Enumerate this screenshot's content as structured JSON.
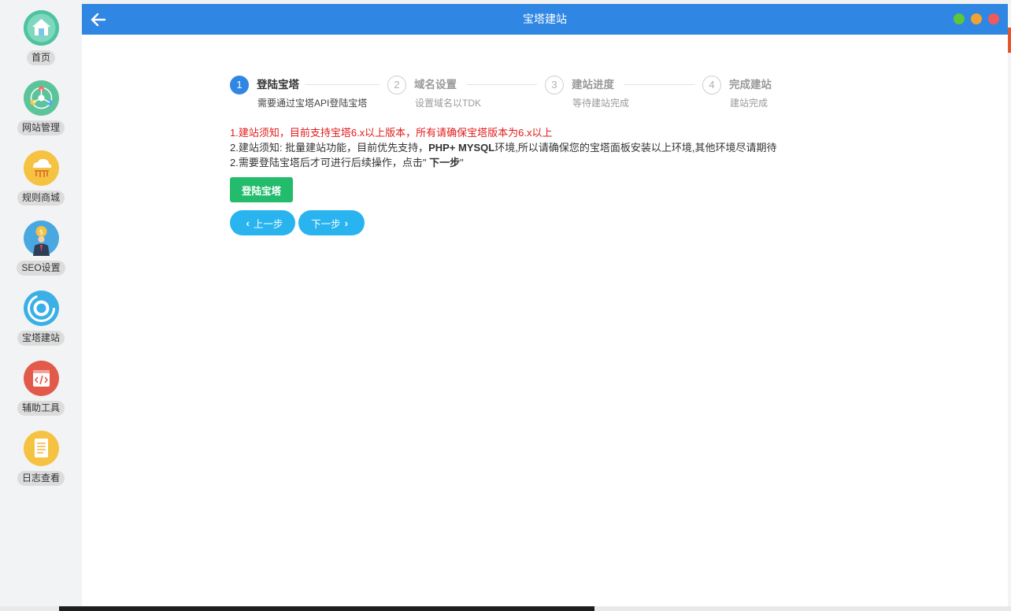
{
  "window": {
    "title": "宝塔建站"
  },
  "sidebar": {
    "items": [
      {
        "label": "首页",
        "icon": "home-icon"
      },
      {
        "label": "网站管理",
        "icon": "network-icon"
      },
      {
        "label": "规则商城",
        "icon": "cloud-icon"
      },
      {
        "label": "SEO设置",
        "icon": "seo-person-icon"
      },
      {
        "label": "宝塔建站",
        "icon": "bt-icon"
      },
      {
        "label": "辅助工具",
        "icon": "code-icon"
      },
      {
        "label": "日志查看",
        "icon": "document-icon"
      }
    ]
  },
  "steps": [
    {
      "num": "1",
      "title": "登陆宝塔",
      "desc": "需要通过宝塔API登陆宝塔",
      "state": "active"
    },
    {
      "num": "2",
      "title": "域名设置",
      "desc": "设置域名以TDK",
      "state": "inactive"
    },
    {
      "num": "3",
      "title": "建站进度",
      "desc": "等待建站完成",
      "state": "inactive"
    },
    {
      "num": "4",
      "title": "完成建站",
      "desc": "建站完成",
      "state": "inactive"
    }
  ],
  "notices": {
    "line1": "1.建站须知，目前支持宝塔6.x以上版本，所有请确保宝塔版本为6.x以上",
    "line2_pre": "2.建站须知: 批量建站功能，目前优先支持，",
    "line2_bold": "PHP+ MYSQL",
    "line2_post": "环境,所以请确保您的宝塔面板安装以上环境,其他环境尽请期待",
    "line3_pre": "2.需要登陆宝塔后才可进行后续操作，点击\"",
    "line3_bold": " 下一步",
    "line3_post": "\""
  },
  "buttons": {
    "login": "登陆宝塔",
    "prev": "上一步",
    "next": "下一步"
  },
  "colors": {
    "titlebar": "#2f86e3",
    "step_active": "#2f86e3",
    "notice_red": "#e21b1b",
    "login_button": "#22bc6c",
    "nav_button": "#29b4f0"
  }
}
